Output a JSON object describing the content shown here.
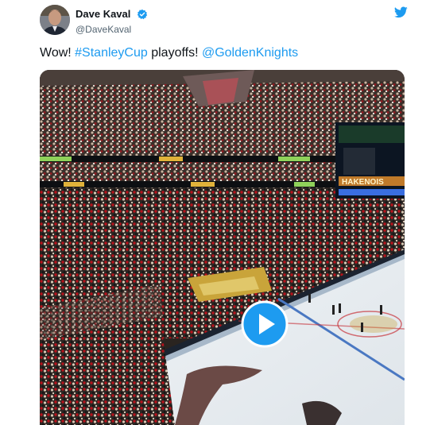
{
  "tweet": {
    "author": {
      "display_name": "Dave Kaval",
      "handle": "@DaveKaval",
      "verified": true
    },
    "text_parts": [
      {
        "text": "Wow! ",
        "type": "text"
      },
      {
        "text": "#StanleyCup",
        "type": "hashtag"
      },
      {
        "text": " playoffs! ",
        "type": "text"
      },
      {
        "text": "@GoldenKnights",
        "type": "mention"
      }
    ]
  },
  "media": {
    "type": "video",
    "scoreboard_text": "HAKENOIS"
  },
  "colors": {
    "link": "#1d9bf0",
    "play_button": "#1d9bf0",
    "verified": "#1d9bf0"
  },
  "icons": {
    "verified": "verified-badge-icon",
    "brand": "twitter-bird-icon",
    "play": "play-icon"
  }
}
